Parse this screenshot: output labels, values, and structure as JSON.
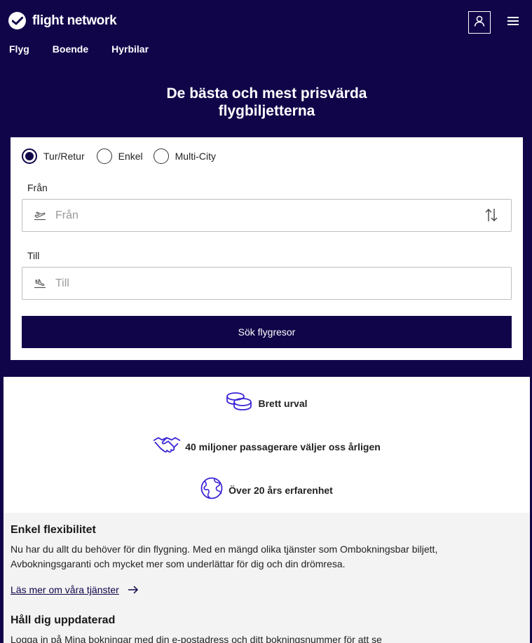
{
  "header": {
    "brand": "flight network",
    "nav": [
      "Flyg",
      "Boende",
      "Hyrbilar"
    ],
    "icons": {
      "logo": "check-circle-icon",
      "account": "user-icon",
      "menu": "hamburger-icon"
    }
  },
  "hero": {
    "title_line1": "De bästa och mest prisvärda",
    "title_line2": "flygbiljetterna"
  },
  "search": {
    "trip_types": [
      "Tur/Retur",
      "Enkel",
      "Multi-City"
    ],
    "selected_trip_type": "Tur/Retur",
    "from_label": "Från",
    "from_placeholder": "Från",
    "to_label": "Till",
    "to_placeholder": "Till",
    "submit_label": "Sök flygresor"
  },
  "usps": [
    {
      "text": "Brett urval",
      "icon": "coins-icon"
    },
    {
      "text": "40 miljoner passagerare väljer oss årligen",
      "icon": "handshake-icon"
    },
    {
      "text": "Över 20 års erfarenhet",
      "icon": "globe-icon"
    }
  ],
  "info": {
    "flex_title": "Enkel flexibilitet",
    "flex_text": "Nu har du allt du behöver för din flygning. Med en mängd olika tjänster som Ombokningsbar biljett, Avbokningsgaranti och mycket mer som underlättar för dig och din drömresa.",
    "flex_link": "Läs mer om våra tjänster",
    "update_title": "Håll dig uppdaterad",
    "update_text": "Logga in på Mina bokningar med din e-postadress och ditt bokningsnummer för att se"
  },
  "colors": {
    "brand": "#11054a",
    "accent": "#3b25d6"
  }
}
